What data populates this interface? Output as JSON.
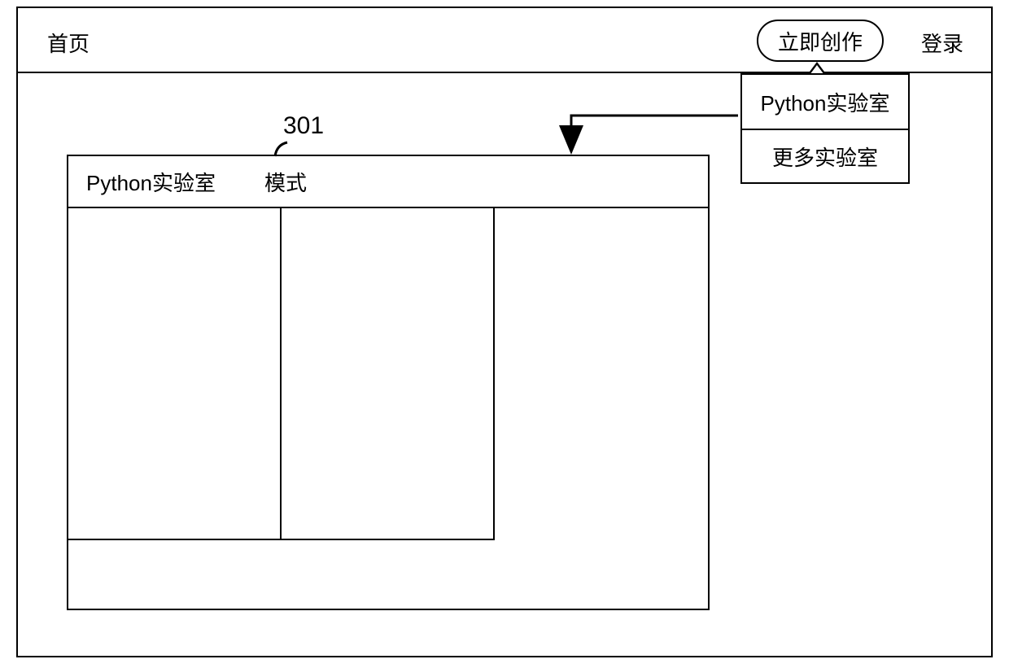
{
  "header": {
    "home_label": "首页",
    "create_label": "立即创作",
    "login_label": "登录"
  },
  "dropdown": {
    "items": [
      {
        "label": "Python实验室"
      },
      {
        "label": "更多实验室"
      }
    ]
  },
  "panel": {
    "title": "Python实验室",
    "mode_label": "模式"
  },
  "annotations": {
    "callout_number": "301"
  }
}
